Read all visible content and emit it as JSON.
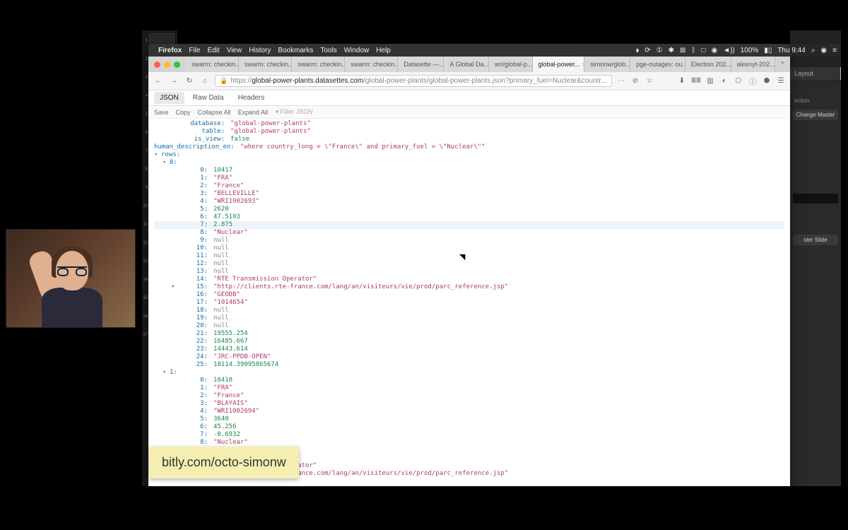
{
  "menubar": {
    "app": "Firefox",
    "items": [
      "File",
      "Edit",
      "View",
      "History",
      "Bookmarks",
      "Tools",
      "Window",
      "Help"
    ],
    "battery": "100%",
    "clock": "Thu 9:44"
  },
  "tabs": {
    "items": [
      {
        "label": "swarm: checkin..."
      },
      {
        "label": "swarm: checkin..."
      },
      {
        "label": "swarm: checkin..."
      },
      {
        "label": "swarm: checkin..."
      },
      {
        "label": "Datasette —..."
      },
      {
        "label": "A Global Da..."
      },
      {
        "label": "wri/global-p..."
      },
      {
        "label": "global-power...",
        "active": true
      },
      {
        "label": "simonw/glob..."
      },
      {
        "label": "pge-outages: ou..."
      },
      {
        "label": "Election 202..."
      },
      {
        "label": "alexnyt-202..."
      }
    ]
  },
  "url": {
    "host": "global-power-plants.datasettes.com",
    "path": "/global-power-plants/global-power-plants.json?primary_fuel=Nuclear&countr..."
  },
  "jsonviewer": {
    "tabs": [
      "JSON",
      "Raw Data",
      "Headers"
    ],
    "active_tab": "JSON",
    "actions": [
      "Save",
      "Copy",
      "Collapse All",
      "Expand All"
    ],
    "filter_placeholder": "Filter JSON"
  },
  "json": {
    "top": [
      {
        "k": "database:",
        "v": "\"global-power-plants\"",
        "t": "str"
      },
      {
        "k": "table:",
        "v": "\"global-power-plants\"",
        "t": "str"
      },
      {
        "k": "is_view:",
        "v": "false",
        "t": "bool"
      },
      {
        "k": "human_description_en:",
        "v": "\"where country_long = \\\"France\\\" and primary_fuel = \\\"Nuclear\\\"\"",
        "t": "str"
      }
    ],
    "rows_label": "rows:",
    "row0_label": "0:",
    "row0": [
      {
        "k": "0:",
        "v": "10417",
        "t": "num"
      },
      {
        "k": "1:",
        "v": "\"FRA\"",
        "t": "str"
      },
      {
        "k": "2:",
        "v": "\"France\"",
        "t": "str"
      },
      {
        "k": "3:",
        "v": "\"BELLEVILLE\"",
        "t": "str"
      },
      {
        "k": "4:",
        "v": "\"WRI1002693\"",
        "t": "str"
      },
      {
        "k": "5:",
        "v": "2620",
        "t": "num"
      },
      {
        "k": "6:",
        "v": "47.5103",
        "t": "num"
      },
      {
        "k": "7:",
        "v": "2.875",
        "t": "num",
        "hilite": true
      },
      {
        "k": "8:",
        "v": "\"Nuclear\"",
        "t": "str"
      },
      {
        "k": "9:",
        "v": "null",
        "t": "null"
      },
      {
        "k": "10:",
        "v": "null",
        "t": "null"
      },
      {
        "k": "11:",
        "v": "null",
        "t": "null"
      },
      {
        "k": "12:",
        "v": "null",
        "t": "null"
      },
      {
        "k": "13:",
        "v": "null",
        "t": "null"
      },
      {
        "k": "14:",
        "v": "\"RTE Transmission Operator\"",
        "t": "str"
      },
      {
        "k": "15:",
        "v": "\"http://clients.rte-france.com/lang/an/visiteurs/vie/prod/parc_reference.jsp\"",
        "t": "str"
      },
      {
        "k": "16:",
        "v": "\"GEODB\"",
        "t": "str"
      },
      {
        "k": "17:",
        "v": "\"1014654\"",
        "t": "str"
      },
      {
        "k": "18:",
        "v": "null",
        "t": "null"
      },
      {
        "k": "19:",
        "v": "null",
        "t": "null"
      },
      {
        "k": "20:",
        "v": "null",
        "t": "null"
      },
      {
        "k": "21:",
        "v": "19555.254",
        "t": "num"
      },
      {
        "k": "22:",
        "v": "16485.667",
        "t": "num"
      },
      {
        "k": "23:",
        "v": "14443.614",
        "t": "num"
      },
      {
        "k": "24:",
        "v": "\"JRC-PPDB-OPEN\"",
        "t": "str"
      },
      {
        "k": "25:",
        "v": "18114.39095865674",
        "t": "num"
      }
    ],
    "row1_label": "1:",
    "row1": [
      {
        "k": "0:",
        "v": "10418",
        "t": "num"
      },
      {
        "k": "1:",
        "v": "\"FRA\"",
        "t": "str"
      },
      {
        "k": "2:",
        "v": "\"France\"",
        "t": "str"
      },
      {
        "k": "3:",
        "v": "\"BLAYAIS\"",
        "t": "str"
      },
      {
        "k": "4:",
        "v": "\"WRI1002694\"",
        "t": "str"
      },
      {
        "k": "5:",
        "v": "3640",
        "t": "num"
      },
      {
        "k": "6:",
        "v": "45.256",
        "t": "num"
      },
      {
        "k": "7:",
        "v": "-0.6932",
        "t": "num"
      },
      {
        "k": "8:",
        "v": "\"Nuclear\"",
        "t": "str"
      },
      {
        "k": "9:",
        "v": "null",
        "t": "null"
      },
      {
        "k": "10:",
        "v": "null",
        "t": "null"
      }
    ],
    "row1_extra": [
      {
        "k": "14:",
        "v": "\"RTE Transmission Operator\"",
        "t": "str"
      },
      {
        "k": "15:",
        "v": "\"http://clients.rte-france.com/lang/an/visiteurs/vie/prod/parc_reference.jsp\"",
        "t": "str"
      }
    ]
  },
  "bitly": "bitly.com/octo-simonw",
  "rightpanel": {
    "tab1": "Layout",
    "sec1": "ection",
    "btn1": "Change Master",
    "btn2": "ster Slide"
  },
  "slidenums": [
    "1",
    "2",
    "3",
    "4",
    "5",
    "6",
    "7",
    "8",
    "9",
    "10",
    "11",
    "12",
    "13",
    "14",
    "15",
    "16",
    "17"
  ]
}
